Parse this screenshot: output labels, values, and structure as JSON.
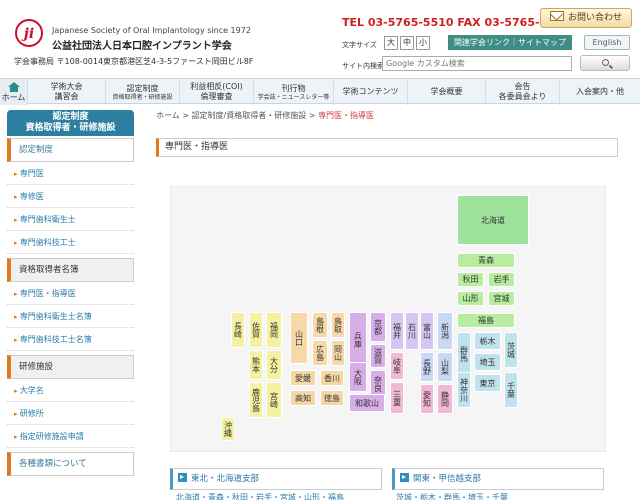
{
  "header": {
    "org_en": "Japanese Society of Oral Implantology since 1972",
    "org_ja": "公益社団法人日本口腔インプラント学会",
    "address": "学会事務局 〒108-0014東京都港区芝4-3-5ファースト岡田ビル8F",
    "tel_label": "TEL",
    "tel": "03-5765-5510",
    "fax_label": "FAX",
    "fax": "03-5765-5516",
    "contact_button": "お問い合わせ",
    "font_size_label": "文字サイズ",
    "font_sizes": [
      "大",
      "中",
      "小"
    ],
    "links_bar": "関連学会リンク｜サイトマップ",
    "english_button": "English",
    "search_label": "サイト内検索",
    "search_placeholder": "Google カスタム検索"
  },
  "nav": [
    {
      "label": "ホーム",
      "sub": ""
    },
    {
      "label": "学術大会",
      "sub": "講習会"
    },
    {
      "label": "認定制度",
      "sub": "資格取得者・研修施設"
    },
    {
      "label": "利益相反(COI)",
      "sub": "倫理審査"
    },
    {
      "label": "刊行物",
      "sub": "学会誌・ニュースレター等"
    },
    {
      "label": "学術コンテンツ",
      "sub": ""
    },
    {
      "label": "学会概要",
      "sub": ""
    },
    {
      "label": "会告",
      "sub": "各委員会より"
    },
    {
      "label": "入会案内・他",
      "sub": ""
    }
  ],
  "breadcrumb": {
    "home": "ホーム",
    "sep": ">",
    "mid": "認定制度/資格取得者・研修施設",
    "current": "専門医・指導医"
  },
  "page_title": "専門医・指導医",
  "sidebar": {
    "heading_line1": "認定制度",
    "heading_line2": "資格取得者・研修施設",
    "sections": [
      {
        "title": "認定制度",
        "items": [
          "専門医",
          "専修医",
          "専門歯科衛生士",
          "専門歯科技工士"
        ]
      },
      {
        "title": "資格取得者名簿",
        "items": [
          "専門医・指導医",
          "専門歯科衛生士名簿",
          "専門歯科技工士名簿"
        ]
      },
      {
        "title": "研修施設",
        "items": [
          "大学名",
          "研修所",
          "指定研修施設申請"
        ]
      },
      {
        "title": "各種書類について",
        "items": []
      }
    ]
  },
  "map": {
    "prefectures": [
      {
        "id": "hokkaido",
        "name": "北海道",
        "region": "hokkaido"
      },
      {
        "id": "aomori",
        "name": "青森",
        "region": "tohoku"
      },
      {
        "id": "akita",
        "name": "秋田",
        "region": "tohoku"
      },
      {
        "id": "iwate",
        "name": "岩手",
        "region": "tohoku"
      },
      {
        "id": "yamagata",
        "name": "山形",
        "region": "tohoku"
      },
      {
        "id": "miyagi",
        "name": "宮城",
        "region": "tohoku"
      },
      {
        "id": "fukushima",
        "name": "福島",
        "region": "tohoku"
      },
      {
        "id": "gunma",
        "name": "群馬",
        "region": "kanto"
      },
      {
        "id": "tochigi",
        "name": "栃木",
        "region": "kanto"
      },
      {
        "id": "ibaraki",
        "name": "茨城",
        "region": "kanto"
      },
      {
        "id": "saitama",
        "name": "埼玉",
        "region": "kanto"
      },
      {
        "id": "kanagawa",
        "name": "神奈川",
        "region": "kanto"
      },
      {
        "id": "tokyo",
        "name": "東京",
        "region": "kanto"
      },
      {
        "id": "chiba",
        "name": "千葉",
        "region": "kanto"
      },
      {
        "id": "niigata",
        "name": "新潟",
        "region": "koshinetsu"
      },
      {
        "id": "nagano",
        "name": "長野",
        "region": "koshinetsu"
      },
      {
        "id": "yamanashi",
        "name": "山梨",
        "region": "koshinetsu"
      },
      {
        "id": "toyama",
        "name": "富山",
        "region": "hokuriku"
      },
      {
        "id": "ishikawa",
        "name": "石川",
        "region": "hokuriku"
      },
      {
        "id": "fukui",
        "name": "福井",
        "region": "hokuriku"
      },
      {
        "id": "gifu",
        "name": "岐阜",
        "region": "tokai"
      },
      {
        "id": "aichi",
        "name": "愛知",
        "region": "tokai"
      },
      {
        "id": "mie",
        "name": "三重",
        "region": "tokai"
      },
      {
        "id": "shizuoka",
        "name": "静岡",
        "region": "tokai"
      },
      {
        "id": "kyoto",
        "name": "京都",
        "region": "kinki"
      },
      {
        "id": "shiga",
        "name": "滋賀",
        "region": "kinki"
      },
      {
        "id": "hyogo",
        "name": "兵庫",
        "region": "kinki"
      },
      {
        "id": "osaka",
        "name": "大阪",
        "region": "kinki"
      },
      {
        "id": "nara",
        "name": "奈良",
        "region": "kinki"
      },
      {
        "id": "wakayama",
        "name": "和歌山",
        "region": "kinki"
      },
      {
        "id": "tottori",
        "name": "鳥取",
        "region": "chugoku"
      },
      {
        "id": "shimane",
        "name": "島根",
        "region": "chugoku"
      },
      {
        "id": "okayama",
        "name": "岡山",
        "region": "chugoku"
      },
      {
        "id": "hiroshima",
        "name": "広島",
        "region": "chugoku"
      },
      {
        "id": "yamaguchi",
        "name": "山口",
        "region": "chugoku"
      },
      {
        "id": "kagawa",
        "name": "香川",
        "region": "shikoku"
      },
      {
        "id": "ehime",
        "name": "愛媛",
        "region": "shikoku"
      },
      {
        "id": "tokushima",
        "name": "徳島",
        "region": "shikoku"
      },
      {
        "id": "kochi",
        "name": "高知",
        "region": "shikoku"
      },
      {
        "id": "fukuoka",
        "name": "福岡",
        "region": "kyushu"
      },
      {
        "id": "saga",
        "name": "佐賀",
        "region": "kyushu"
      },
      {
        "id": "nagasaki",
        "name": "長崎",
        "region": "kyushu"
      },
      {
        "id": "oita",
        "name": "大分",
        "region": "kyushu"
      },
      {
        "id": "kumamoto",
        "name": "熊本",
        "region": "kyushu"
      },
      {
        "id": "miyazaki",
        "name": "宮崎",
        "region": "kyushu"
      },
      {
        "id": "kagoshima",
        "name": "鹿児島",
        "region": "kyushu"
      },
      {
        "id": "okinawa",
        "name": "沖縄",
        "region": "kyushu"
      }
    ]
  },
  "regions": {
    "tohoku_title": "東北・北海道支部",
    "kanto_title": "関東・甲信越支部",
    "tohoku_prefs": "北海道・青森・秋田・岩手・宮城・山形・福島",
    "kanto_prefs": "茨城・栃木・群馬・埼玉・千葉"
  },
  "colors": {
    "accent_orange": "#e07a1a",
    "teal": "#3f8e86",
    "sidebar_header": "#2c7fa0",
    "tel_red": "#d0201c"
  }
}
